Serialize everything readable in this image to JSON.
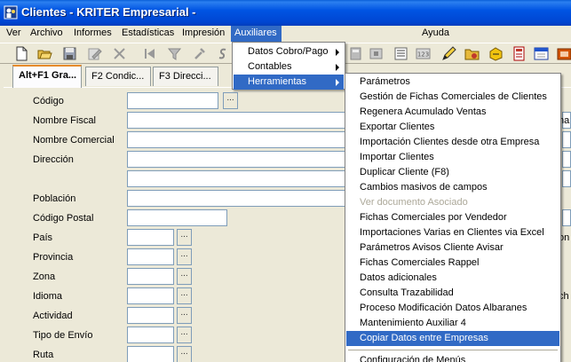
{
  "window": {
    "title": "Clientes - KRITER Empresarial -"
  },
  "menubar": {
    "items": [
      "Ver",
      "Archivo",
      "Informes",
      "Estadísticas",
      "Impresión",
      "Auxiliares",
      "Ayuda"
    ]
  },
  "tabs": [
    "Alt+F1 Gra...",
    "F2 Condic...",
    "F3 Direcci..."
  ],
  "form": {
    "labels": [
      "Código",
      "Nombre Fiscal",
      "Nombre Comercial",
      "Dirección",
      "Población",
      "Código Postal",
      "País",
      "Provincia",
      "Zona",
      "Idioma",
      "Actividad",
      "Tipo de Envío",
      "Ruta"
    ],
    "lookup_button": "..."
  },
  "auxmenu": {
    "items": [
      "Datos Cobro/Pago",
      "Contables",
      "Herramientas"
    ]
  },
  "toolsmenu": {
    "items": [
      "Parámetros",
      "Gestión de Fichas Comerciales de Clientes",
      "Regenera Acumulado Ventas",
      "Exportar Clientes",
      "Importación Clientes desde otra Empresa",
      "Importar Clientes",
      "Duplicar Cliente (F8)",
      "Cambios masivos de campos",
      "Ver documento Asociado",
      "Fichas Comerciales por Vendedor",
      "Importaciones Varias en Clientes via Excel",
      "Parámetros Avisos Cliente Avisar",
      "Fichas Comerciales Rappel",
      "Datos adicionales",
      "Consulta Trazabilidad",
      "Proceso Modificación Datos Albaranes",
      "Mantenimiento Auxiliar 4",
      "Copiar Datos entre Empresas",
      "Configuración de Menús"
    ]
  },
  "right_edge": {
    "text_a": "na",
    "text_b": "on",
    "text_c": "ch"
  },
  "colors": {
    "titlebar": "#0054e3",
    "highlight": "#316ac5",
    "face": "#ece9d8",
    "disabled": "#aca899"
  },
  "icons": [
    "new-icon",
    "open-icon",
    "save-icon",
    "edit-icon",
    "delete-icon",
    "first-icon",
    "filter-icon",
    "tools-icon",
    "currency-icon",
    "calculator-icon",
    "folder-icon",
    "report-icon",
    "calendar-icon",
    "chart-icon",
    "box-icon"
  ]
}
